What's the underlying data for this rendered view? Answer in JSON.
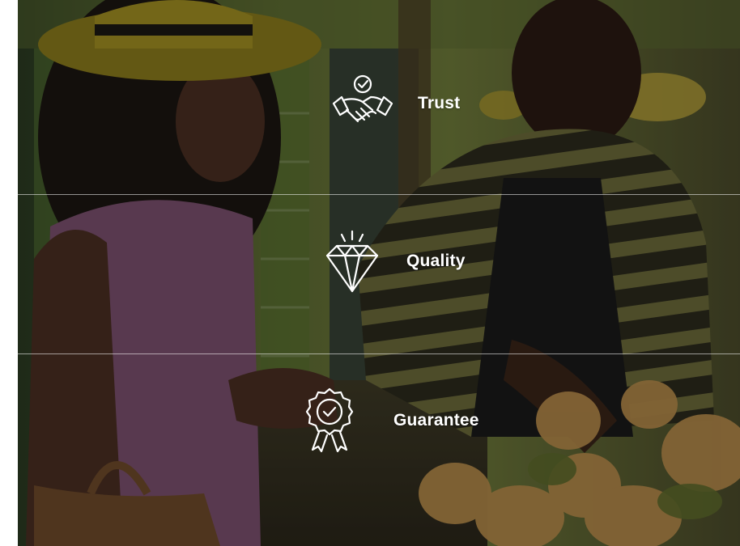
{
  "features": [
    {
      "label": "Trust",
      "icon": "handshake-check-icon"
    },
    {
      "label": "Quality",
      "icon": "diamond-icon"
    },
    {
      "label": "Guarantee",
      "icon": "award-ribbon-icon"
    }
  ],
  "colors": {
    "text": "#ffffff",
    "divider": "#c8c8c8",
    "overlay": "#1a1a1a"
  }
}
